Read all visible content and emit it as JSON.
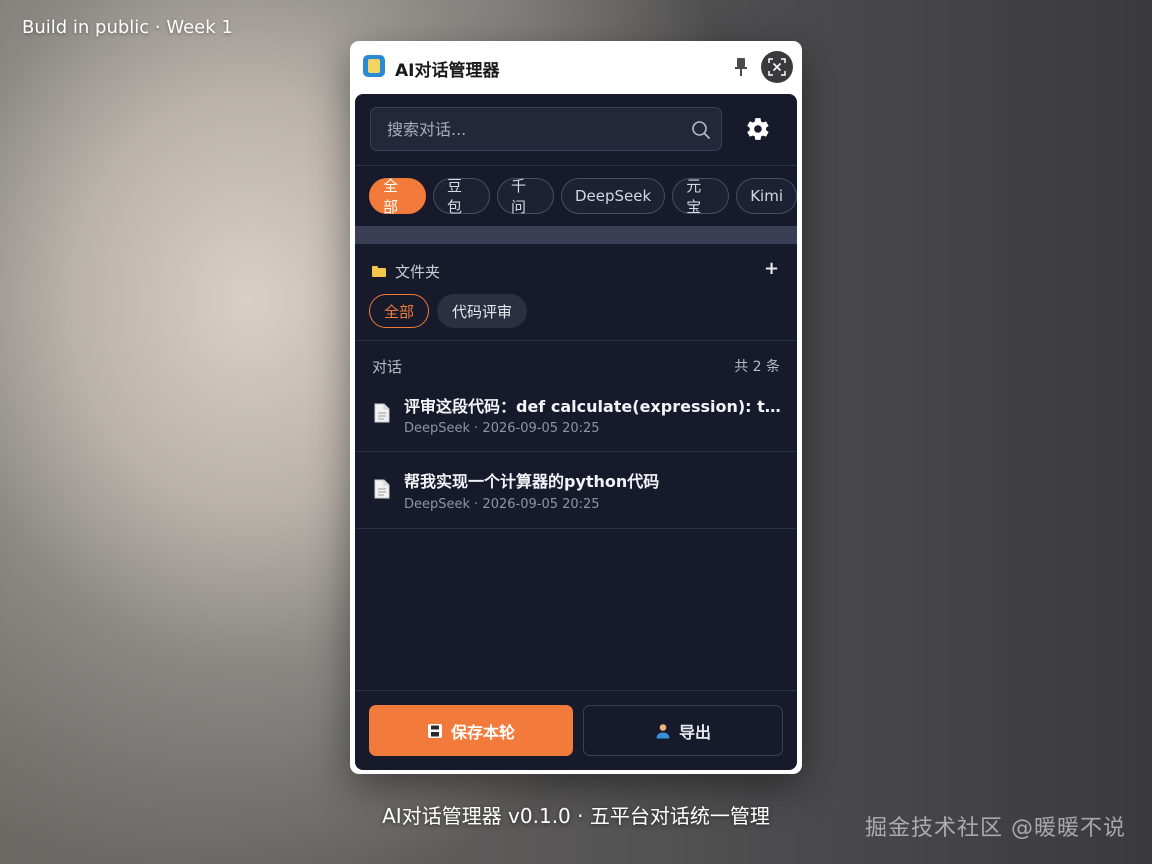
{
  "captions": {
    "top": "Build in public · Week 1",
    "bottom": "AI对话管理器 v0.1.0 · 五平台对话统一管理",
    "watermark": "掘金技术社区 @暖暖不说"
  },
  "window": {
    "title": "AI对话管理器",
    "icons": {
      "app": "app-logo-icon",
      "pin": "pin-icon",
      "close": "close-window-icon"
    }
  },
  "search": {
    "placeholder": "搜索对话..."
  },
  "settings": {
    "icon": "gear-icon"
  },
  "platform_tabs": [
    {
      "label": "全部",
      "active": true
    },
    {
      "label": "豆包",
      "active": false
    },
    {
      "label": "千问",
      "active": false
    },
    {
      "label": "DeepSeek",
      "active": false
    },
    {
      "label": "元宝",
      "active": false
    },
    {
      "label": "Kimi",
      "active": false
    }
  ],
  "folders": {
    "title": "文件夹",
    "add_label": "+",
    "chips": [
      {
        "label": "全部",
        "active": true
      },
      {
        "label": "代码评审",
        "active": false
      }
    ]
  },
  "conversations": {
    "title": "对话",
    "count": "共 2 条",
    "items": [
      {
        "title": "评审这段代码：def calculate(expression): try: ...",
        "meta": "DeepSeek · 2026-09-05 20:25"
      },
      {
        "title": "帮我实现一个计算器的python代码",
        "meta": "DeepSeek · 2026-09-05 20:25"
      }
    ]
  },
  "actions": {
    "save_label": "保存本轮",
    "export_label": "导出"
  },
  "colors": {
    "accent": "#f27a3a",
    "panel_bg": "#161a2b",
    "folder_icon": "#f2c74a"
  }
}
